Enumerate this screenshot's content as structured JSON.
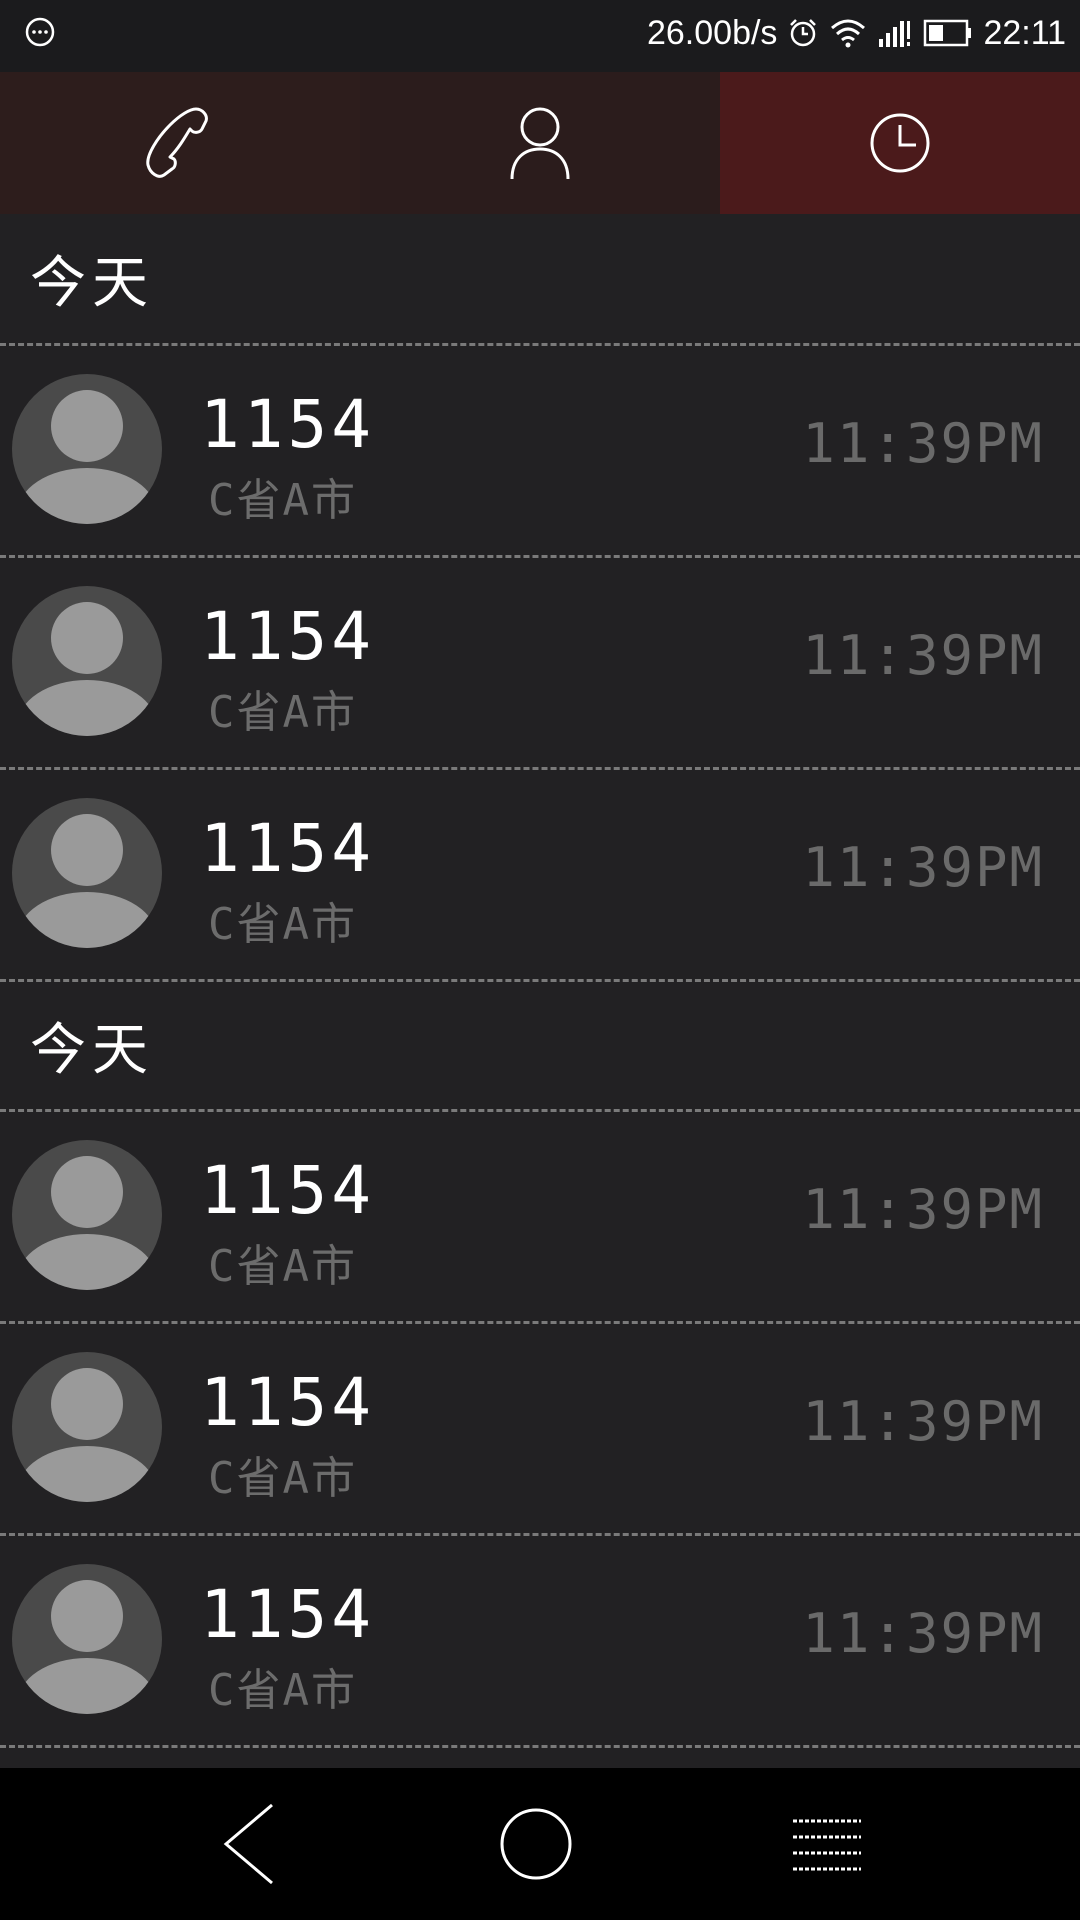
{
  "status_bar": {
    "speed": "26.00b/s",
    "time": "22:11",
    "icons": [
      "notification-icon",
      "alarm-icon",
      "wifi-icon",
      "signal-icon",
      "battery-icon"
    ]
  },
  "tabs": [
    {
      "icon": "phone-icon",
      "label": ""
    },
    {
      "icon": "contact-icon",
      "label": ""
    },
    {
      "icon": "clock-icon",
      "label": ""
    }
  ],
  "sections": [
    {
      "header": "今天",
      "calls": [
        {
          "number": "1154",
          "location": "C省A市",
          "time": "11:39PM"
        },
        {
          "number": "1154",
          "location": "C省A市",
          "time": "11:39PM"
        },
        {
          "number": "1154",
          "location": "C省A市",
          "time": "11:39PM"
        }
      ]
    },
    {
      "header": "今天",
      "calls": [
        {
          "number": "1154",
          "location": "C省A市",
          "time": "11:39PM"
        },
        {
          "number": "1154",
          "location": "C省A市",
          "time": "11:39PM"
        },
        {
          "number": "1154",
          "location": "C省A市",
          "time": "11:39PM"
        }
      ]
    }
  ],
  "colors": {
    "active_tab": "#4b1a1b",
    "tab_bg": "#2d1d1c",
    "list_bg": "#222123",
    "divider": "#7a7a7a"
  },
  "navbar": {
    "icons": [
      "back-icon",
      "home-icon",
      "menu-icon"
    ]
  }
}
